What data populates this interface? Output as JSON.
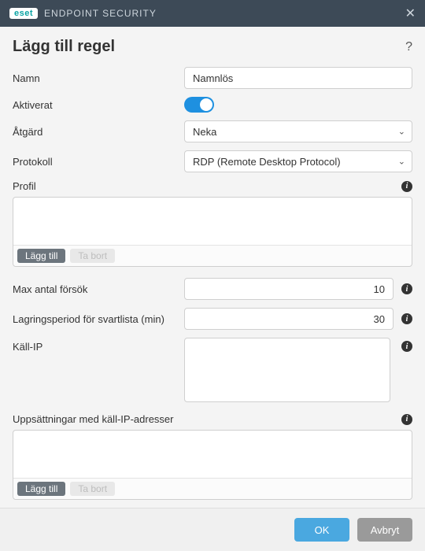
{
  "titlebar": {
    "brand": "eset",
    "product": "ENDPOINT SECURITY"
  },
  "page": {
    "title": "Lägg till regel",
    "help": "?"
  },
  "fields": {
    "name": {
      "label": "Namn",
      "value": "Namnlös"
    },
    "enabled": {
      "label": "Aktiverat",
      "on": true
    },
    "action": {
      "label": "Åtgärd",
      "value": "Neka"
    },
    "protocol": {
      "label": "Protokoll",
      "value": "RDP (Remote Desktop Protocol)"
    },
    "profile": {
      "label": "Profil",
      "add": "Lägg till",
      "remove": "Ta bort"
    },
    "max_attempts": {
      "label": "Max antal försök",
      "value": "10"
    },
    "blacklist_period": {
      "label": "Lagringsperiod för svartlista (min)",
      "value": "30"
    },
    "source_ip": {
      "label": "Käll-IP"
    },
    "source_ip_sets": {
      "label": "Uppsättningar med käll-IP-adresser",
      "add": "Lägg till",
      "remove": "Ta bort"
    }
  },
  "buttons": {
    "ok": "OK",
    "cancel": "Avbryt"
  },
  "icons": {
    "info": "i",
    "chevron": "⌄",
    "close": "✕"
  }
}
